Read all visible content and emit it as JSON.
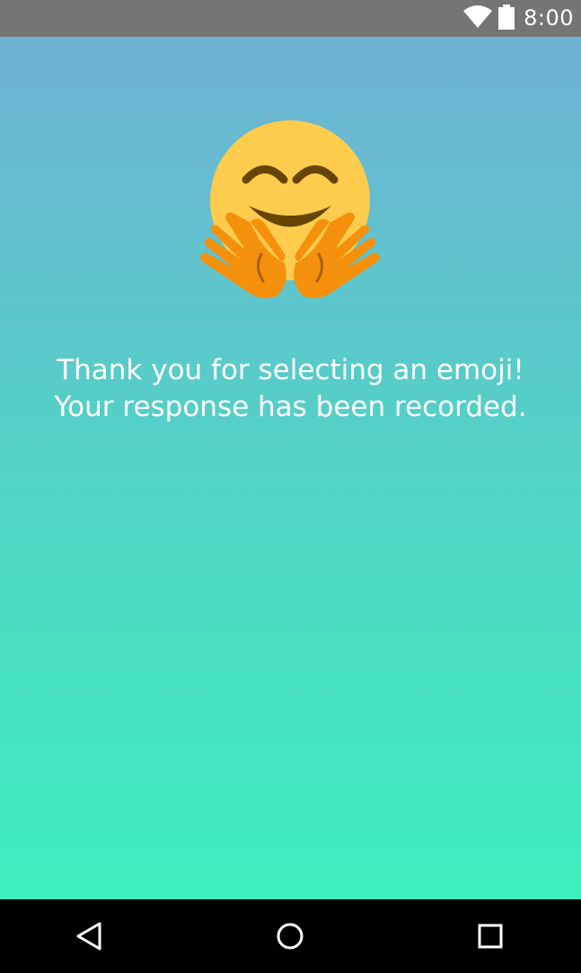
{
  "status_bar": {
    "time": "8:00",
    "icons": [
      "wifi-icon",
      "battery-icon"
    ]
  },
  "main": {
    "emoji": "hugging-face-icon",
    "message_line_1": "Thank you for selecting an emoji!",
    "message_line_2": "Your response has been recorded."
  },
  "nav_bar": {
    "icons": [
      "back-icon",
      "home-icon",
      "recents-icon"
    ]
  },
  "colors": {
    "status_bar_bg": "#757575",
    "gradient_top": "#6fb1d4",
    "gradient_bottom": "#3deebe",
    "nav_bar_bg": "#000000",
    "text": "#ffffff"
  }
}
